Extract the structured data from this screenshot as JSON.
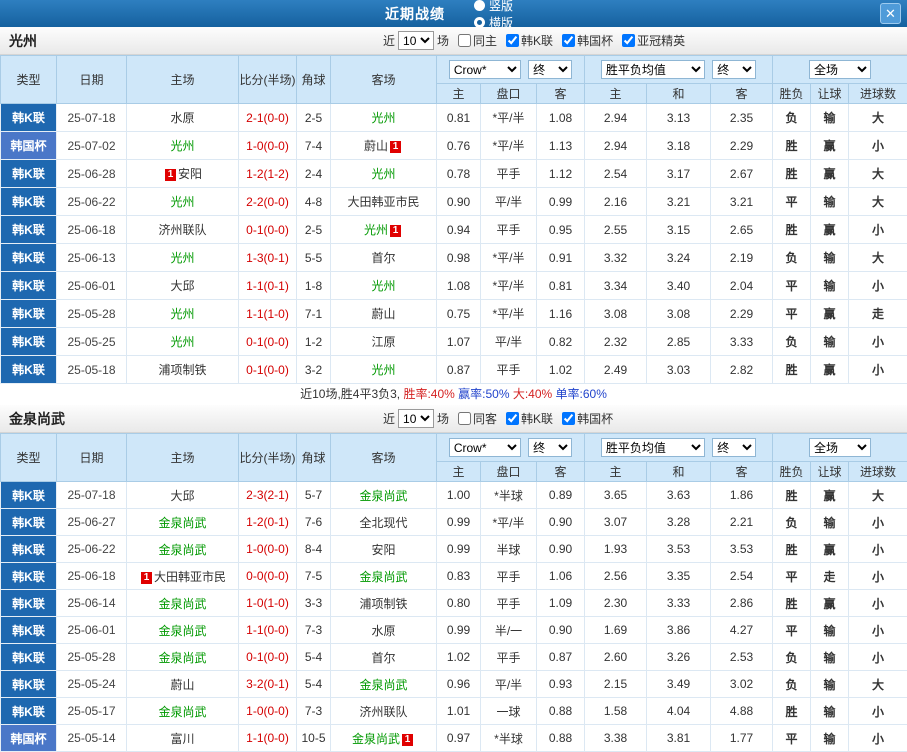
{
  "titlebar": {
    "title": "近期战绩",
    "layout_options": [
      {
        "label": "竖版",
        "selected": false
      },
      {
        "label": "横版",
        "selected": true
      }
    ],
    "close_icon": "✕"
  },
  "colors": {
    "accent_blue": "#15619f",
    "league": {
      "韩K联": "#1e68b0",
      "韩国杯": "#4a77c8"
    },
    "team_highlight": "#009900",
    "score_red": "#d40000"
  },
  "filter_labels": {
    "near": "近",
    "games": "场"
  },
  "table_headers": {
    "type": "类型",
    "date": "日期",
    "home": "主场",
    "score": "比分(半场)",
    "corner": "角球",
    "away": "客场",
    "bookmaker_select": "Crow*",
    "stage_select": "终",
    "odds_cols": [
      "主",
      "盘口",
      "客"
    ],
    "europe_select": "胜平负均值",
    "europe_stage_select": "终",
    "europe_cols": [
      "主",
      "和",
      "客"
    ],
    "scope_select": "全场",
    "result_cols": [
      "胜负",
      "让球",
      "进球数"
    ]
  },
  "sections": [
    {
      "team": "光州",
      "games_count": "10",
      "filters": [
        {
          "label": "同主",
          "checked": false
        },
        {
          "label": "韩K联",
          "checked": true
        },
        {
          "label": "韩国杯",
          "checked": true
        },
        {
          "label": "亚冠精英",
          "checked": true
        }
      ],
      "rows": [
        {
          "league": "韩K联",
          "date": "25-07-18",
          "home": "水原",
          "score": "2-1(0-0)",
          "corner": "2-5",
          "away": "光州",
          "odds": [
            "0.81",
            "*平/半",
            "1.08"
          ],
          "europe": [
            "2.94",
            "3.13",
            "2.35"
          ],
          "results": [
            "负",
            "输",
            "大"
          ]
        },
        {
          "league": "韩国杯",
          "date": "25-07-02",
          "home": "光州",
          "score": "1-0(0-0)",
          "corner": "7-4",
          "away": "蔚山",
          "away_badge": "1",
          "away_badge_pos": "after",
          "odds": [
            "0.76",
            "*平/半",
            "1.13"
          ],
          "europe": [
            "2.94",
            "3.18",
            "2.29"
          ],
          "results": [
            "胜",
            "赢",
            "小"
          ]
        },
        {
          "league": "韩K联",
          "date": "25-06-28",
          "home": "安阳",
          "home_badge": "1",
          "home_badge_pos": "before",
          "score": "1-2(1-2)",
          "corner": "2-4",
          "away": "光州",
          "odds": [
            "0.78",
            "平手",
            "1.12"
          ],
          "europe": [
            "2.54",
            "3.17",
            "2.67"
          ],
          "results": [
            "胜",
            "赢",
            "大"
          ]
        },
        {
          "league": "韩K联",
          "date": "25-06-22",
          "home": "光州",
          "score": "2-2(0-0)",
          "corner": "4-8",
          "away": "大田韩亚市民",
          "odds": [
            "0.90",
            "平/半",
            "0.99"
          ],
          "europe": [
            "2.16",
            "3.21",
            "3.21"
          ],
          "results": [
            "平",
            "输",
            "大"
          ]
        },
        {
          "league": "韩K联",
          "date": "25-06-18",
          "home": "济州联队",
          "score": "0-1(0-0)",
          "corner": "2-5",
          "away": "光州",
          "away_badge": "1",
          "away_badge_pos": "after",
          "odds": [
            "0.94",
            "平手",
            "0.95"
          ],
          "europe": [
            "2.55",
            "3.15",
            "2.65"
          ],
          "results": [
            "胜",
            "赢",
            "小"
          ]
        },
        {
          "league": "韩K联",
          "date": "25-06-13",
          "home": "光州",
          "score": "1-3(0-1)",
          "corner": "5-5",
          "away": "首尔",
          "odds": [
            "0.98",
            "*平/半",
            "0.91"
          ],
          "europe": [
            "3.32",
            "3.24",
            "2.19"
          ],
          "results": [
            "负",
            "输",
            "大"
          ]
        },
        {
          "league": "韩K联",
          "date": "25-06-01",
          "home": "大邱",
          "score": "1-1(0-1)",
          "corner": "1-8",
          "away": "光州",
          "odds": [
            "1.08",
            "*平/半",
            "0.81"
          ],
          "europe": [
            "3.34",
            "3.40",
            "2.04"
          ],
          "results": [
            "平",
            "输",
            "小"
          ]
        },
        {
          "league": "韩K联",
          "date": "25-05-28",
          "home": "光州",
          "score": "1-1(1-0)",
          "corner": "7-1",
          "away": "蔚山",
          "odds": [
            "0.75",
            "*平/半",
            "1.16"
          ],
          "europe": [
            "3.08",
            "3.08",
            "2.29"
          ],
          "results": [
            "平",
            "赢",
            "走"
          ]
        },
        {
          "league": "韩K联",
          "date": "25-05-25",
          "home": "光州",
          "score": "0-1(0-0)",
          "corner": "1-2",
          "away": "江原",
          "odds": [
            "1.07",
            "平/半",
            "0.82"
          ],
          "europe": [
            "2.32",
            "2.85",
            "3.33"
          ],
          "results": [
            "负",
            "输",
            "小"
          ]
        },
        {
          "league": "韩K联",
          "date": "25-05-18",
          "home": "浦项制铁",
          "score": "0-1(0-0)",
          "corner": "3-2",
          "away": "光州",
          "odds": [
            "0.87",
            "平手",
            "1.02"
          ],
          "europe": [
            "2.49",
            "3.03",
            "2.82"
          ],
          "results": [
            "胜",
            "赢",
            "小"
          ]
        }
      ],
      "summary": [
        {
          "text": "近10场,胜4平3负3, ",
          "color": "#333333"
        },
        {
          "text": "胜率:40%",
          "color": "#d42222"
        },
        {
          "text": " 赢率:50%",
          "color": "#2244cc"
        },
        {
          "text": " 大:40%",
          "color": "#d42222"
        },
        {
          "text": " 单率:60%",
          "color": "#2244cc"
        }
      ]
    },
    {
      "team": "金泉尚武",
      "games_count": "10",
      "filters": [
        {
          "label": "同客",
          "checked": false
        },
        {
          "label": "韩K联",
          "checked": true
        },
        {
          "label": "韩国杯",
          "checked": true
        }
      ],
      "rows": [
        {
          "league": "韩K联",
          "date": "25-07-18",
          "home": "大邱",
          "score": "2-3(2-1)",
          "corner": "5-7",
          "away": "金泉尚武",
          "odds": [
            "1.00",
            "*半球",
            "0.89"
          ],
          "europe": [
            "3.65",
            "3.63",
            "1.86"
          ],
          "results": [
            "胜",
            "赢",
            "大"
          ]
        },
        {
          "league": "韩K联",
          "date": "25-06-27",
          "home": "金泉尚武",
          "score": "1-2(0-1)",
          "corner": "7-6",
          "away": "全北现代",
          "odds": [
            "0.99",
            "*平/半",
            "0.90"
          ],
          "europe": [
            "3.07",
            "3.28",
            "2.21"
          ],
          "results": [
            "负",
            "输",
            "小"
          ]
        },
        {
          "league": "韩K联",
          "date": "25-06-22",
          "home": "金泉尚武",
          "score": "1-0(0-0)",
          "corner": "8-4",
          "away": "安阳",
          "odds": [
            "0.99",
            "半球",
            "0.90"
          ],
          "europe": [
            "1.93",
            "3.53",
            "3.53"
          ],
          "results": [
            "胜",
            "赢",
            "小"
          ]
        },
        {
          "league": "韩K联",
          "date": "25-06-18",
          "home": "大田韩亚市民",
          "home_badge": "1",
          "home_badge_pos": "before",
          "score": "0-0(0-0)",
          "corner": "7-5",
          "away": "金泉尚武",
          "odds": [
            "0.83",
            "平手",
            "1.06"
          ],
          "europe": [
            "2.56",
            "3.35",
            "2.54"
          ],
          "results": [
            "平",
            "走",
            "小"
          ]
        },
        {
          "league": "韩K联",
          "date": "25-06-14",
          "home": "金泉尚武",
          "score": "1-0(1-0)",
          "corner": "3-3",
          "away": "浦项制铁",
          "odds": [
            "0.80",
            "平手",
            "1.09"
          ],
          "europe": [
            "2.30",
            "3.33",
            "2.86"
          ],
          "results": [
            "胜",
            "赢",
            "小"
          ]
        },
        {
          "league": "韩K联",
          "date": "25-06-01",
          "home": "金泉尚武",
          "score": "1-1(0-0)",
          "corner": "7-3",
          "away": "水原",
          "odds": [
            "0.99",
            "半/一",
            "0.90"
          ],
          "europe": [
            "1.69",
            "3.86",
            "4.27"
          ],
          "results": [
            "平",
            "输",
            "小"
          ]
        },
        {
          "league": "韩K联",
          "date": "25-05-28",
          "home": "金泉尚武",
          "score": "0-1(0-0)",
          "corner": "5-4",
          "away": "首尔",
          "odds": [
            "1.02",
            "平手",
            "0.87"
          ],
          "europe": [
            "2.60",
            "3.26",
            "2.53"
          ],
          "results": [
            "负",
            "输",
            "小"
          ]
        },
        {
          "league": "韩K联",
          "date": "25-05-24",
          "home": "蔚山",
          "score": "3-2(0-1)",
          "corner": "5-4",
          "away": "金泉尚武",
          "odds": [
            "0.96",
            "平/半",
            "0.93"
          ],
          "europe": [
            "2.15",
            "3.49",
            "3.02"
          ],
          "results": [
            "负",
            "输",
            "大"
          ]
        },
        {
          "league": "韩K联",
          "date": "25-05-17",
          "home": "金泉尚武",
          "score": "1-0(0-0)",
          "corner": "7-3",
          "away": "济州联队",
          "odds": [
            "1.01",
            "一球",
            "0.88"
          ],
          "europe": [
            "1.58",
            "4.04",
            "4.88"
          ],
          "results": [
            "胜",
            "输",
            "小"
          ]
        },
        {
          "league": "韩国杯",
          "date": "25-05-14",
          "home": "富川",
          "score": "1-1(0-0)",
          "corner": "10-5",
          "away": "金泉尚武",
          "away_badge": "1",
          "away_badge_pos": "after",
          "odds": [
            "0.97",
            "*半球",
            "0.88"
          ],
          "europe": [
            "3.38",
            "3.81",
            "1.77"
          ],
          "results": [
            "平",
            "输",
            "小"
          ]
        }
      ]
    }
  ]
}
